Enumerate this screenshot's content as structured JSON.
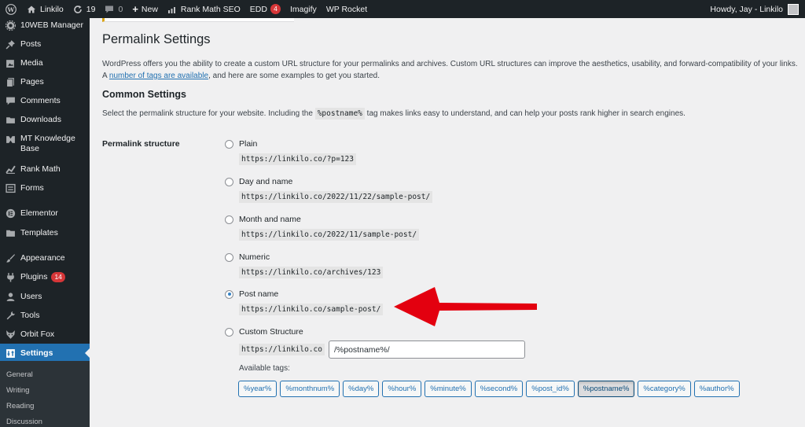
{
  "admin_bar": {
    "site_name": "Linkilo",
    "updates_count": "19",
    "comments_count": "0",
    "new_label": "New",
    "rank_math": "Rank Math SEO",
    "edd": "EDD",
    "edd_badge": "4",
    "imagify": "Imagify",
    "wp_rocket": "WP Rocket",
    "howdy": "Howdy, Jay - Linkilo"
  },
  "sidebar": {
    "items": [
      {
        "label": "10WEB Manager",
        "icon": "gear-icon"
      },
      {
        "label": "Posts",
        "icon": "pin-icon"
      },
      {
        "label": "Media",
        "icon": "media-icon"
      },
      {
        "label": "Pages",
        "icon": "page-icon"
      },
      {
        "label": "Comments",
        "icon": "comment-icon"
      },
      {
        "label": "Downloads",
        "icon": "download-icon"
      },
      {
        "label": "MT Knowledge Base",
        "icon": "book-icon"
      },
      {
        "label": "Rank Math",
        "icon": "chart-icon"
      },
      {
        "label": "Forms",
        "icon": "form-icon"
      },
      {
        "label": "Elementor",
        "icon": "elementor-icon"
      },
      {
        "label": "Templates",
        "icon": "folder-icon"
      },
      {
        "label": "Appearance",
        "icon": "brush-icon"
      },
      {
        "label": "Plugins",
        "icon": "plug-icon",
        "badge": "14"
      },
      {
        "label": "Users",
        "icon": "user-icon"
      },
      {
        "label": "Tools",
        "icon": "wrench-icon"
      },
      {
        "label": "Orbit Fox",
        "icon": "fox-icon"
      },
      {
        "label": "Settings",
        "icon": "settings-icon"
      }
    ],
    "submenu": [
      "General",
      "Writing",
      "Reading",
      "Discussion"
    ]
  },
  "page": {
    "title": "Permalink Settings",
    "intro_text": "WordPress offers you the ability to create a custom URL structure for your permalinks and archives. Custom URL structures can improve the aesthetics, usability, and forward-compatibility of your links. A ",
    "intro_link": "number of tags are available",
    "intro_tail": ", and here are some examples to get you started.",
    "common_heading": "Common Settings",
    "desc_before": "Select the permalink structure for your website. Including the ",
    "desc_code": "%postname%",
    "desc_after": " tag makes links easy to understand, and can help your posts rank higher in search engines.",
    "structure_label": "Permalink structure",
    "options": [
      {
        "label": "Plain",
        "example": "https://linkilo.co/?p=123"
      },
      {
        "label": "Day and name",
        "example": "https://linkilo.co/2022/11/22/sample-post/"
      },
      {
        "label": "Month and name",
        "example": "https://linkilo.co/2022/11/sample-post/"
      },
      {
        "label": "Numeric",
        "example": "https://linkilo.co/archives/123"
      },
      {
        "label": "Post name",
        "example": "https://linkilo.co/sample-post/"
      },
      {
        "label": "Custom Structure"
      }
    ],
    "selected_option": "Post name",
    "custom_prefix": "https://linkilo.co",
    "custom_value": "/%postname%/",
    "available_tags_label": "Available tags:",
    "tags": [
      "%year%",
      "%monthnum%",
      "%day%",
      "%hour%",
      "%minute%",
      "%second%",
      "%post_id%",
      "%postname%",
      "%category%",
      "%author%"
    ],
    "active_tag": "%postname%"
  },
  "colors": {
    "admin_dark": "#1d2327",
    "accent": "#2271b1",
    "badge": "#d63638",
    "arrow": "#e3000f"
  }
}
